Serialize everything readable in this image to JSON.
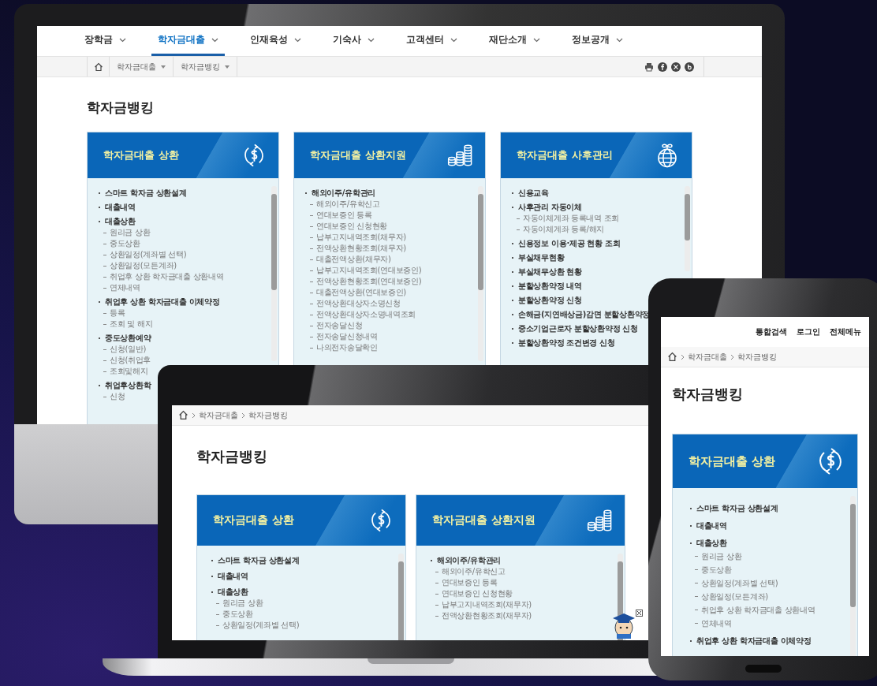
{
  "monitor": {
    "nav": [
      {
        "label": "장학금",
        "selected": false
      },
      {
        "label": "학자금대출",
        "selected": true
      },
      {
        "label": "인재육성",
        "selected": false
      },
      {
        "label": "기숙사",
        "selected": false
      },
      {
        "label": "고객센터",
        "selected": false
      },
      {
        "label": "재단소개",
        "selected": false
      },
      {
        "label": "정보공개",
        "selected": false
      }
    ],
    "breadcrumb": [
      "학자금대출",
      "학자금뱅킹"
    ],
    "title": "학자금뱅킹",
    "cards": [
      {
        "kind": "dollar",
        "title": "학자금대출 상환",
        "items": [
          {
            "label": "스마트 학자금 상환설계"
          },
          {
            "label": "대출내역"
          },
          {
            "label": "대출상환",
            "children": [
              {
                "label": "원리금 상환"
              },
              {
                "label": "중도상환"
              },
              {
                "label": "상환일정(계좌별 선택)"
              },
              {
                "label": "상환일정(모든계좌)"
              },
              {
                "label": "취업후 상환 학자금대출 상환내역"
              },
              {
                "label": "연체내역"
              }
            ]
          },
          {
            "label": "취업후 상환 학자금대출 이체약정",
            "children": [
              {
                "label": "등록"
              },
              {
                "label": "조회 및 해지"
              }
            ]
          },
          {
            "label": "중도상환예약",
            "children": [
              {
                "label": "신청(일반)"
              },
              {
                "label": "신청(취업후"
              },
              {
                "label": "조회및해지"
              }
            ]
          },
          {
            "label": "취업후상환학",
            "children": [
              {
                "label": "신청"
              }
            ]
          }
        ]
      },
      {
        "kind": "coins",
        "title": "학자금대출 상환지원",
        "items": [
          {
            "label": "해외이주/유학관리",
            "children": [
              {
                "label": "해외이주/유학신고"
              },
              {
                "label": "연대보증인 등록"
              },
              {
                "label": "연대보증인 신청현황"
              },
              {
                "label": "납부고지내역조회(채무자)"
              },
              {
                "label": "전액상환현황조회(채무자)"
              },
              {
                "label": "대출전액상환(채무자)"
              },
              {
                "label": "납부고지내역조회(연대보증인)"
              },
              {
                "label": "전액상환현황조회(연대보증인)"
              },
              {
                "label": "대출전액상환(연대보증인)"
              },
              {
                "label": "전액상환대상자소명신청"
              },
              {
                "label": "전액상환대상자소명내역조회"
              },
              {
                "label": "전자송달신청"
              },
              {
                "label": "전자송달신청내역"
              },
              {
                "label": "나의전자송달확인"
              }
            ]
          }
        ]
      },
      {
        "kind": "globe",
        "title": "학자금대출 사후관리",
        "items": [
          {
            "label": "신용교육"
          },
          {
            "label": "사후관리 자동이체",
            "children": [
              {
                "label": "자동이체계좌 등록내역 조회"
              },
              {
                "label": "자동이체계좌 등록/해지"
              }
            ]
          },
          {
            "label": "신용정보 이용·제공 현황 조회"
          },
          {
            "label": "부실채무현황"
          },
          {
            "label": "부실채무상환 현황"
          },
          {
            "label": "분할상환약정 내역"
          },
          {
            "label": "분할상환약정 신청"
          },
          {
            "label": "손해금(지연배상금)감면 분할상환약정"
          },
          {
            "label": "중소기업근로자 분할상환약정 신청"
          },
          {
            "label": "분할상환약정 조건변경 신청"
          }
        ]
      }
    ]
  },
  "laptop": {
    "breadcrumb": [
      "학자금대출",
      "학자금뱅킹"
    ],
    "title": "학자금뱅킹",
    "cards": [
      {
        "kind": "dollar",
        "title": "학자금대출 상환",
        "items": [
          {
            "label": "스마트 학자금 상환설계"
          },
          {
            "label": "대출내역"
          },
          {
            "label": "대출상환",
            "children": [
              {
                "label": "원리금 상환"
              },
              {
                "label": "중도상환"
              },
              {
                "label": "상환일정(계좌별 선택)"
              }
            ]
          }
        ]
      },
      {
        "kind": "coins",
        "title": "학자금대출 상환지원",
        "items": [
          {
            "label": "해외이주/유학관리",
            "children": [
              {
                "label": "해외이주/유학신고"
              },
              {
                "label": "연대보증인 등록"
              },
              {
                "label": "연대보증인 신청현황"
              },
              {
                "label": "납부고지내역조회(채무자)"
              },
              {
                "label": "전액상환현황조회(채무자)"
              }
            ]
          }
        ]
      }
    ]
  },
  "phone": {
    "links": [
      "통합검색",
      "로그인",
      "전체메뉴"
    ],
    "breadcrumb": [
      "학자금대출",
      "학자금뱅킹"
    ],
    "title": "학자금뱅킹",
    "cards": [
      {
        "kind": "dollar",
        "title": "학자금대출 상환",
        "items": [
          {
            "label": "스마트 학자금 상환설계"
          },
          {
            "label": "대출내역"
          },
          {
            "label": "대출상환",
            "children": [
              {
                "label": "원리금 상환"
              },
              {
                "label": "중도상환"
              },
              {
                "label": "상환일정(계좌별 선택)"
              },
              {
                "label": "상환일정(모든계좌)"
              },
              {
                "label": "취업후 상환 학자금대출 상환내역"
              },
              {
                "label": "연체내역"
              }
            ]
          },
          {
            "label": "취업후 상환 학자금대출 이체약정"
          }
        ]
      }
    ]
  }
}
